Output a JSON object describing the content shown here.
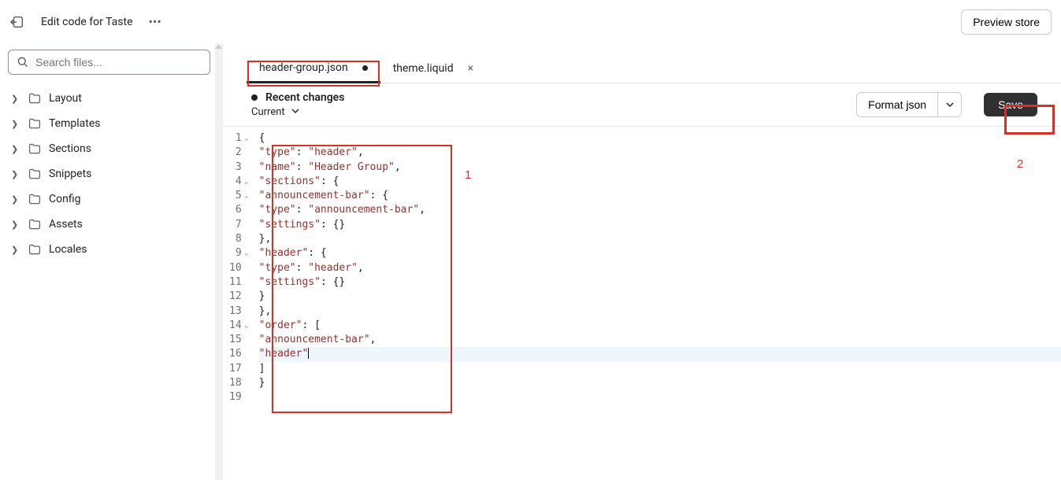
{
  "topbar": {
    "title": "Edit code for Taste",
    "preview_label": "Preview store"
  },
  "search": {
    "placeholder": "Search files..."
  },
  "sidebar": [
    {
      "label": "Layout"
    },
    {
      "label": "Templates"
    },
    {
      "label": "Sections"
    },
    {
      "label": "Snippets"
    },
    {
      "label": "Config"
    },
    {
      "label": "Assets"
    },
    {
      "label": "Locales"
    }
  ],
  "tabs": [
    {
      "label": "header-group.json",
      "dirty": true,
      "active": true
    },
    {
      "label": "theme.liquid",
      "dirty": false,
      "active": false
    }
  ],
  "toolbar": {
    "recent_label": "Recent changes",
    "current_label": "Current",
    "format_label": "Format json",
    "save_label": "Save"
  },
  "code": {
    "tokens": [
      [
        {
          "t": "{",
          "c": "p"
        }
      ],
      [
        {
          "t": "\"type\"",
          "c": "k"
        },
        {
          "t": ": ",
          "c": "p"
        },
        {
          "t": "\"header\"",
          "c": "k"
        },
        {
          "t": ",",
          "c": "p"
        }
      ],
      [
        {
          "t": "\"name\"",
          "c": "k"
        },
        {
          "t": ": ",
          "c": "p"
        },
        {
          "t": "\"Header Group\"",
          "c": "k"
        },
        {
          "t": ",",
          "c": "p"
        }
      ],
      [
        {
          "t": "\"sections\"",
          "c": "k"
        },
        {
          "t": ": {",
          "c": "p"
        }
      ],
      [
        {
          "t": "\"announcement-bar\"",
          "c": "k"
        },
        {
          "t": ": {",
          "c": "p"
        }
      ],
      [
        {
          "t": "\"type\"",
          "c": "k"
        },
        {
          "t": ": ",
          "c": "p"
        },
        {
          "t": "\"announcement-bar\"",
          "c": "k"
        },
        {
          "t": ",",
          "c": "p"
        }
      ],
      [
        {
          "t": "\"settings\"",
          "c": "k"
        },
        {
          "t": ": {}",
          "c": "p"
        }
      ],
      [
        {
          "t": "},",
          "c": "p"
        }
      ],
      [
        {
          "t": "\"header\"",
          "c": "k"
        },
        {
          "t": ": {",
          "c": "p"
        }
      ],
      [
        {
          "t": "\"type\"",
          "c": "k"
        },
        {
          "t": ": ",
          "c": "p"
        },
        {
          "t": "\"header\"",
          "c": "k"
        },
        {
          "t": ",",
          "c": "p"
        }
      ],
      [
        {
          "t": "\"settings\"",
          "c": "k"
        },
        {
          "t": ": {}",
          "c": "p"
        }
      ],
      [
        {
          "t": "}",
          "c": "p"
        }
      ],
      [
        {
          "t": "},",
          "c": "p"
        }
      ],
      [
        {
          "t": "\"order\"",
          "c": "k"
        },
        {
          "t": ": [",
          "c": "p"
        }
      ],
      [
        {
          "t": "\"announcement-bar\"",
          "c": "k"
        },
        {
          "t": ",",
          "c": "p"
        }
      ],
      [
        {
          "t": "\"header\"",
          "c": "k"
        }
      ],
      [
        {
          "t": "]",
          "c": "p"
        }
      ],
      [
        {
          "t": "}",
          "c": "p"
        }
      ],
      []
    ],
    "fold_lines": [
      1,
      4,
      5,
      9,
      14
    ],
    "current_line": 16,
    "cursor_after_line": 16
  },
  "annotations": {
    "label1": "1",
    "label2": "2"
  }
}
